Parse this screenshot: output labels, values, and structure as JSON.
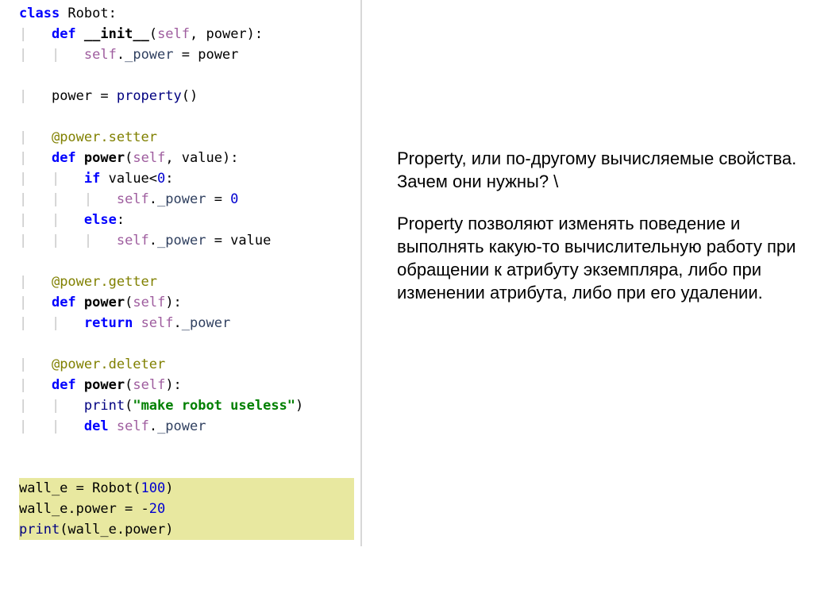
{
  "code": {
    "lines": [
      [
        {
          "c": "kw",
          "t": "class"
        },
        {
          "c": "id",
          "t": " Robot:"
        }
      ],
      [
        {
          "c": "guide",
          "t": "|   "
        },
        {
          "c": "kw",
          "t": "def"
        },
        {
          "c": "id",
          "t": " "
        },
        {
          "c": "fn",
          "t": "__init__"
        },
        {
          "c": "id",
          "t": "("
        },
        {
          "c": "self",
          "t": "self"
        },
        {
          "c": "id",
          "t": ", power):"
        }
      ],
      [
        {
          "c": "guide",
          "t": "|   |   "
        },
        {
          "c": "self",
          "t": "self"
        },
        {
          "c": "id",
          "t": "."
        },
        {
          "c": "pw",
          "t": "_power"
        },
        {
          "c": "id",
          "t": " = power"
        }
      ],
      [],
      [
        {
          "c": "guide",
          "t": "|   "
        },
        {
          "c": "id",
          "t": "power = "
        },
        {
          "c": "bi",
          "t": "property"
        },
        {
          "c": "id",
          "t": "()"
        }
      ],
      [],
      [
        {
          "c": "guide",
          "t": "|   "
        },
        {
          "c": "dec",
          "t": "@power.setter"
        }
      ],
      [
        {
          "c": "guide",
          "t": "|   "
        },
        {
          "c": "kw",
          "t": "def"
        },
        {
          "c": "id",
          "t": " "
        },
        {
          "c": "fn",
          "t": "power"
        },
        {
          "c": "id",
          "t": "("
        },
        {
          "c": "self",
          "t": "self"
        },
        {
          "c": "id",
          "t": ", value):"
        }
      ],
      [
        {
          "c": "guide",
          "t": "|   |   "
        },
        {
          "c": "kw",
          "t": "if"
        },
        {
          "c": "id",
          "t": " value<"
        },
        {
          "c": "num",
          "t": "0"
        },
        {
          "c": "id",
          "t": ":"
        }
      ],
      [
        {
          "c": "guide",
          "t": "|   |   |   "
        },
        {
          "c": "self",
          "t": "self"
        },
        {
          "c": "id",
          "t": "."
        },
        {
          "c": "pw",
          "t": "_power"
        },
        {
          "c": "id",
          "t": " = "
        },
        {
          "c": "num",
          "t": "0"
        }
      ],
      [
        {
          "c": "guide",
          "t": "|   |   "
        },
        {
          "c": "kw",
          "t": "else"
        },
        {
          "c": "id",
          "t": ":"
        }
      ],
      [
        {
          "c": "guide",
          "t": "|   |   |   "
        },
        {
          "c": "self",
          "t": "self"
        },
        {
          "c": "id",
          "t": "."
        },
        {
          "c": "pw",
          "t": "_power"
        },
        {
          "c": "id",
          "t": " = value"
        }
      ],
      [],
      [
        {
          "c": "guide",
          "t": "|   "
        },
        {
          "c": "dec",
          "t": "@power.getter"
        }
      ],
      [
        {
          "c": "guide",
          "t": "|   "
        },
        {
          "c": "kw",
          "t": "def"
        },
        {
          "c": "id",
          "t": " "
        },
        {
          "c": "fn",
          "t": "power"
        },
        {
          "c": "id",
          "t": "("
        },
        {
          "c": "self",
          "t": "self"
        },
        {
          "c": "id",
          "t": "):"
        }
      ],
      [
        {
          "c": "guide",
          "t": "|   |   "
        },
        {
          "c": "kw",
          "t": "return"
        },
        {
          "c": "id",
          "t": " "
        },
        {
          "c": "self",
          "t": "self"
        },
        {
          "c": "id",
          "t": "."
        },
        {
          "c": "pw",
          "t": "_power"
        }
      ],
      [],
      [
        {
          "c": "guide",
          "t": "|   "
        },
        {
          "c": "dec",
          "t": "@power.deleter"
        }
      ],
      [
        {
          "c": "guide",
          "t": "|   "
        },
        {
          "c": "kw",
          "t": "def"
        },
        {
          "c": "id",
          "t": " "
        },
        {
          "c": "fn",
          "t": "power"
        },
        {
          "c": "id",
          "t": "("
        },
        {
          "c": "self",
          "t": "self"
        },
        {
          "c": "id",
          "t": "):"
        }
      ],
      [
        {
          "c": "guide",
          "t": "|   |   "
        },
        {
          "c": "bi",
          "t": "print"
        },
        {
          "c": "id",
          "t": "("
        },
        {
          "c": "str",
          "t": "\"make robot useless\""
        },
        {
          "c": "id",
          "t": ")"
        }
      ],
      [
        {
          "c": "guide",
          "t": "|   |   "
        },
        {
          "c": "kw",
          "t": "del"
        },
        {
          "c": "id",
          "t": " "
        },
        {
          "c": "self",
          "t": "self"
        },
        {
          "c": "id",
          "t": "."
        },
        {
          "c": "pw",
          "t": "_power"
        }
      ],
      [],
      [],
      [
        {
          "c": "id",
          "t": "wall_e = Robot("
        },
        {
          "c": "num",
          "t": "100"
        },
        {
          "c": "id",
          "t": ")"
        }
      ],
      [
        {
          "c": "id",
          "t": "wall_e.power = -"
        },
        {
          "c": "num",
          "t": "20"
        }
      ],
      [
        {
          "c": "bi",
          "t": "print"
        },
        {
          "c": "id",
          "t": "(wall_e.power)"
        }
      ]
    ],
    "highlights": [
      23,
      24,
      25
    ]
  },
  "notes": {
    "p1": " Property, или по-другому вычисляемые свойства. Зачем они нужны? \\",
    "p2": "Property позволяют изменять поведение и выполнять какую-то вычислительную работу при обращении к атрибуту экземпляра, либо при изменении атрибута, либо при его удалении."
  }
}
